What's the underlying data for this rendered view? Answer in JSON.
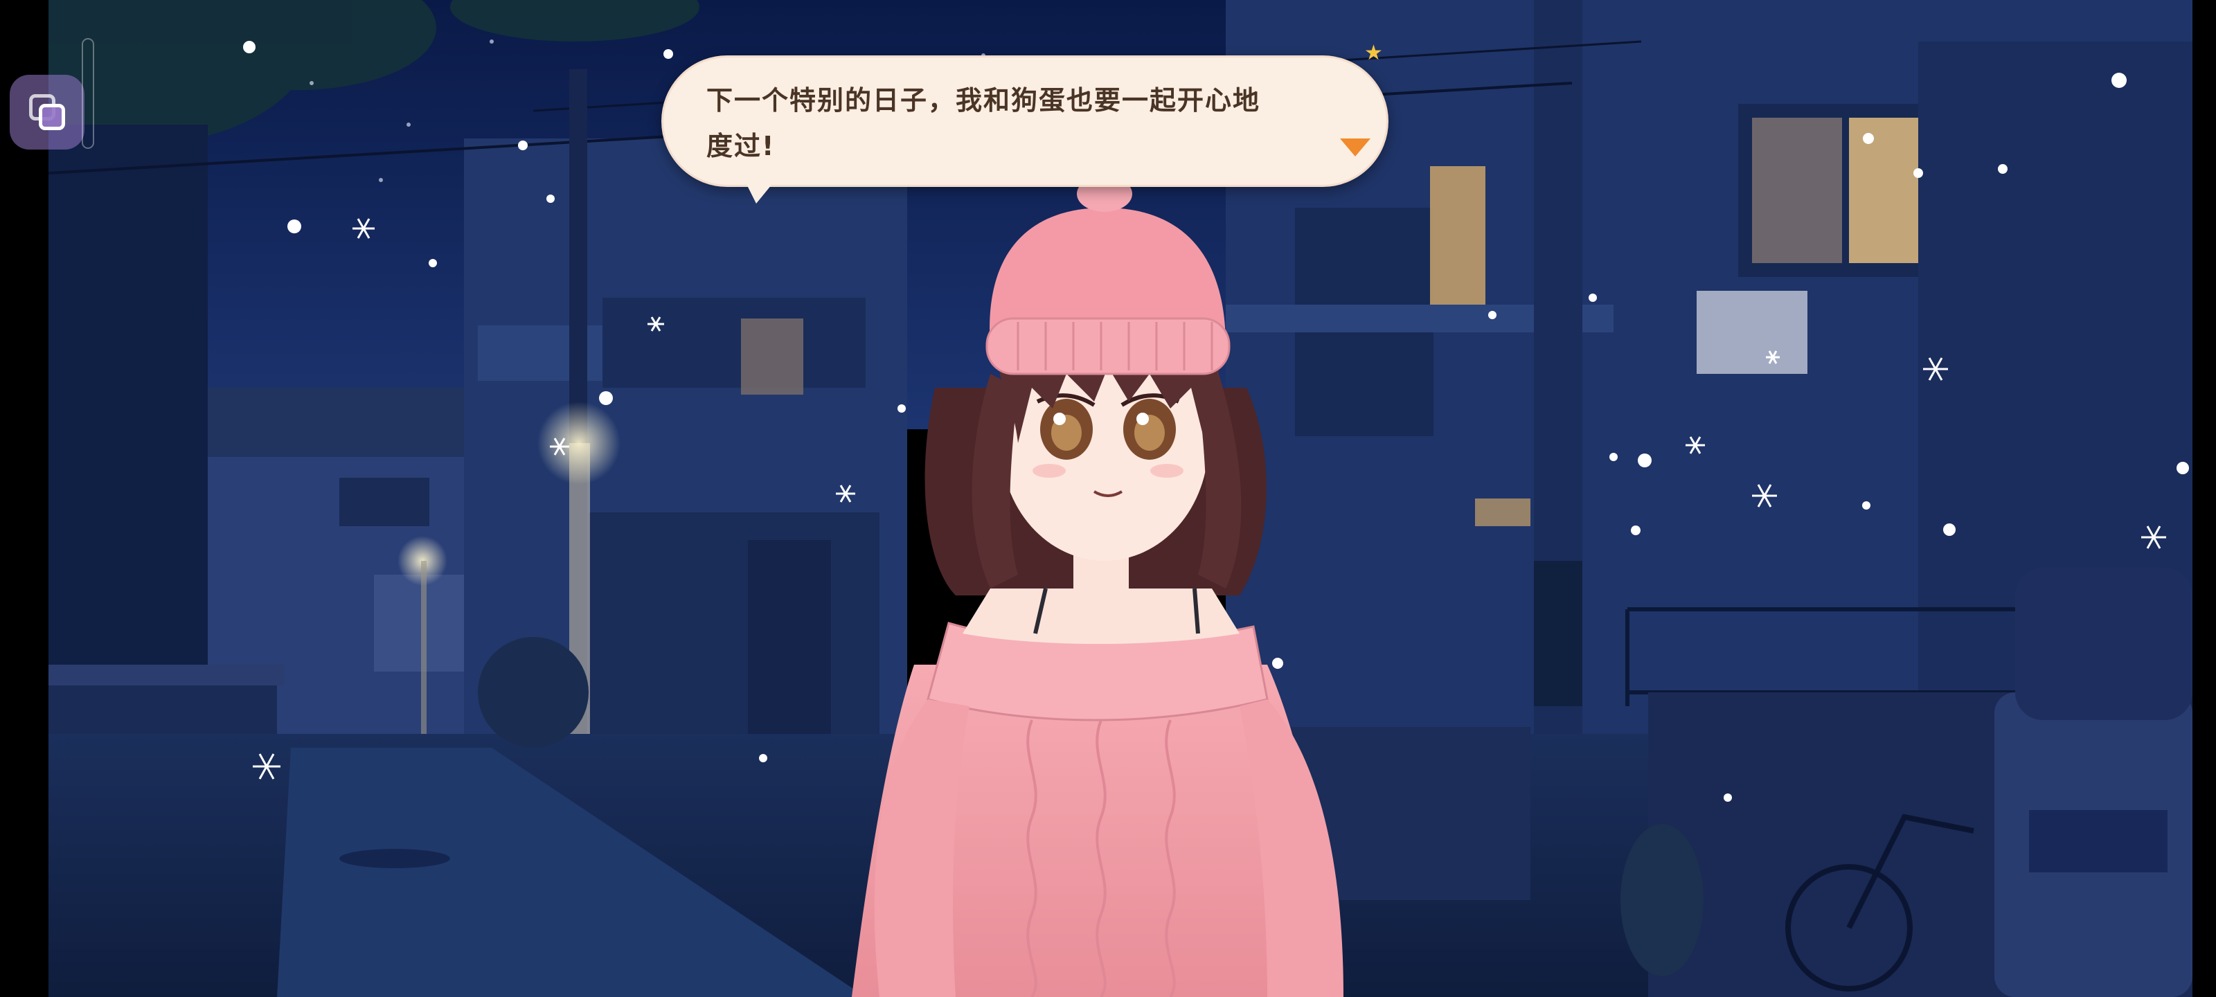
{
  "dialogue": {
    "line1": "下一个特别的日子，我和狗蛋也要一起开心地",
    "line2": "度过!"
  },
  "hud": {
    "menu_icon": "layers-icon",
    "continue_icon": "triangle-down-icon"
  },
  "colors": {
    "sky": "#0c1c4a",
    "bubble": "#fbeee2",
    "bubble_text": "#4a3426",
    "continue_arrow": "#f08a2c",
    "sweater": "#f2a0a8",
    "hat": "#f39aa6",
    "hair": "#5a2f32"
  }
}
